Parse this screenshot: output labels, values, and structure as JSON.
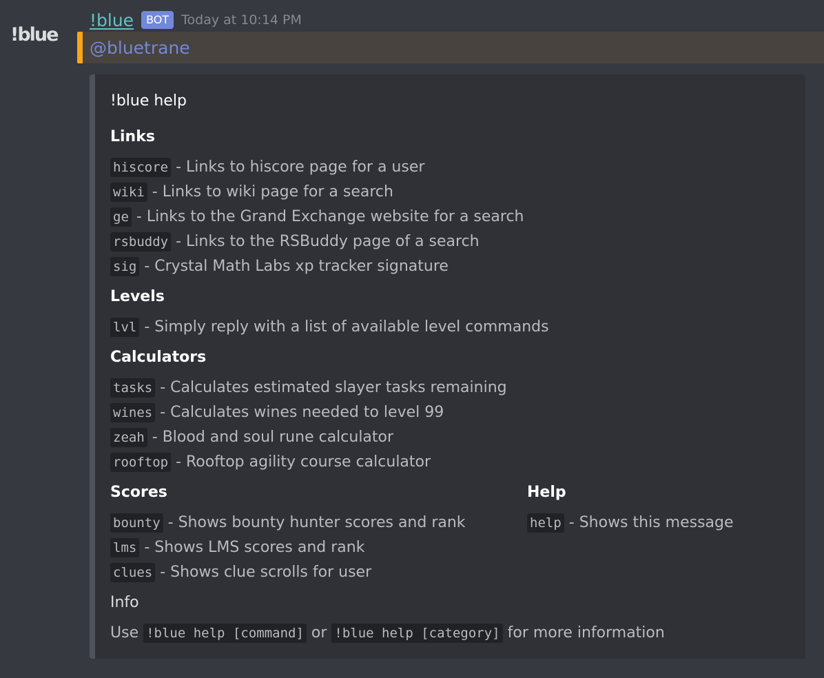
{
  "avatar_text": "!blue",
  "message": {
    "author": "!blue",
    "bot_tag": "BOT",
    "timestamp": "Today at 10:14 PM",
    "mention": "@bluetrane"
  },
  "colors": {
    "background": "#36393f",
    "embed_background": "#2f3136",
    "embed_border": "#4f545c",
    "mention_highlight": "#faa61a",
    "author": "#5ec4c9",
    "bot_tag": "#7289da"
  },
  "embed": {
    "title": "!blue help",
    "fields": {
      "links": {
        "name": "Links",
        "items": [
          {
            "cmd": "hiscore",
            "desc": "- Links to hiscore page for a user"
          },
          {
            "cmd": "wiki",
            "desc": "- Links to wiki page for a search"
          },
          {
            "cmd": "ge",
            "desc": "- Links to the Grand Exchange website for a search"
          },
          {
            "cmd": "rsbuddy",
            "desc": "- Links to the RSBuddy page of a search"
          },
          {
            "cmd": "sig",
            "desc": "- Crystal Math Labs xp tracker signature"
          }
        ]
      },
      "levels": {
        "name": "Levels",
        "items": [
          {
            "cmd": "lvl",
            "desc": "- Simply reply with a list of available level commands"
          }
        ]
      },
      "calculators": {
        "name": "Calculators",
        "items": [
          {
            "cmd": "tasks",
            "desc": "- Calculates estimated slayer tasks remaining"
          },
          {
            "cmd": "wines",
            "desc": "- Calculates wines needed to level 99"
          },
          {
            "cmd": "zeah",
            "desc": "- Blood and soul rune calculator"
          },
          {
            "cmd": "rooftop",
            "desc": "- Rooftop agility course calculator"
          }
        ]
      },
      "scores": {
        "name": "Scores",
        "items": [
          {
            "cmd": "bounty",
            "desc": "- Shows bounty hunter scores and rank"
          },
          {
            "cmd": "lms",
            "desc": "- Shows LMS scores and rank"
          },
          {
            "cmd": "clues",
            "desc": "- Shows clue scrolls for user"
          }
        ]
      },
      "help": {
        "name": "Help",
        "items": [
          {
            "cmd": "help",
            "desc": "- Shows this message"
          }
        ]
      }
    },
    "info": {
      "title": "Info",
      "use": "Use",
      "cmd1": "!blue help [command]",
      "or": "or",
      "cmd2": "!blue help [category]",
      "tail": "for more information"
    }
  }
}
